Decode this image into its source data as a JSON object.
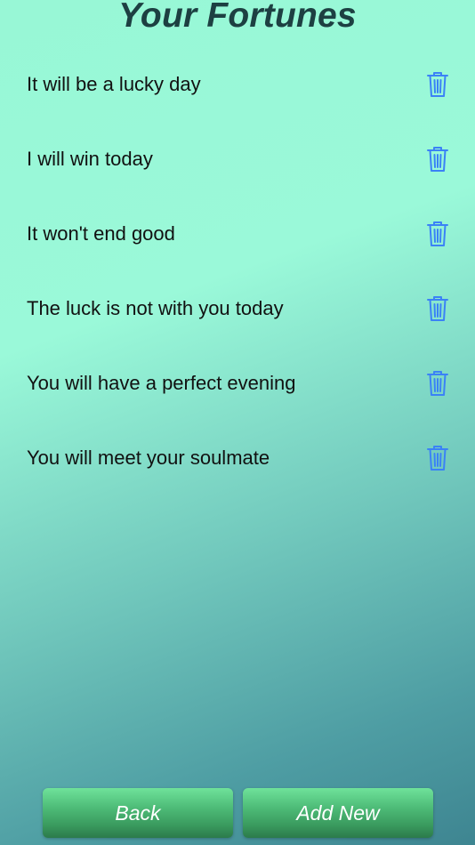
{
  "header": {
    "title": "Your Fortunes"
  },
  "fortunes": [
    {
      "text": "It will be a lucky day"
    },
    {
      "text": "I will win today"
    },
    {
      "text": "It won't end good"
    },
    {
      "text": "The luck is not with you today"
    },
    {
      "text": "You will have a perfect evening"
    },
    {
      "text": "You will meet your soulmate"
    }
  ],
  "icons": {
    "delete": "trash-icon"
  },
  "colors": {
    "accent": "#3b82f6",
    "button_green": "#4dbb77",
    "title": "#1d4042"
  },
  "footer": {
    "back_label": "Back",
    "add_label": "Add New"
  }
}
